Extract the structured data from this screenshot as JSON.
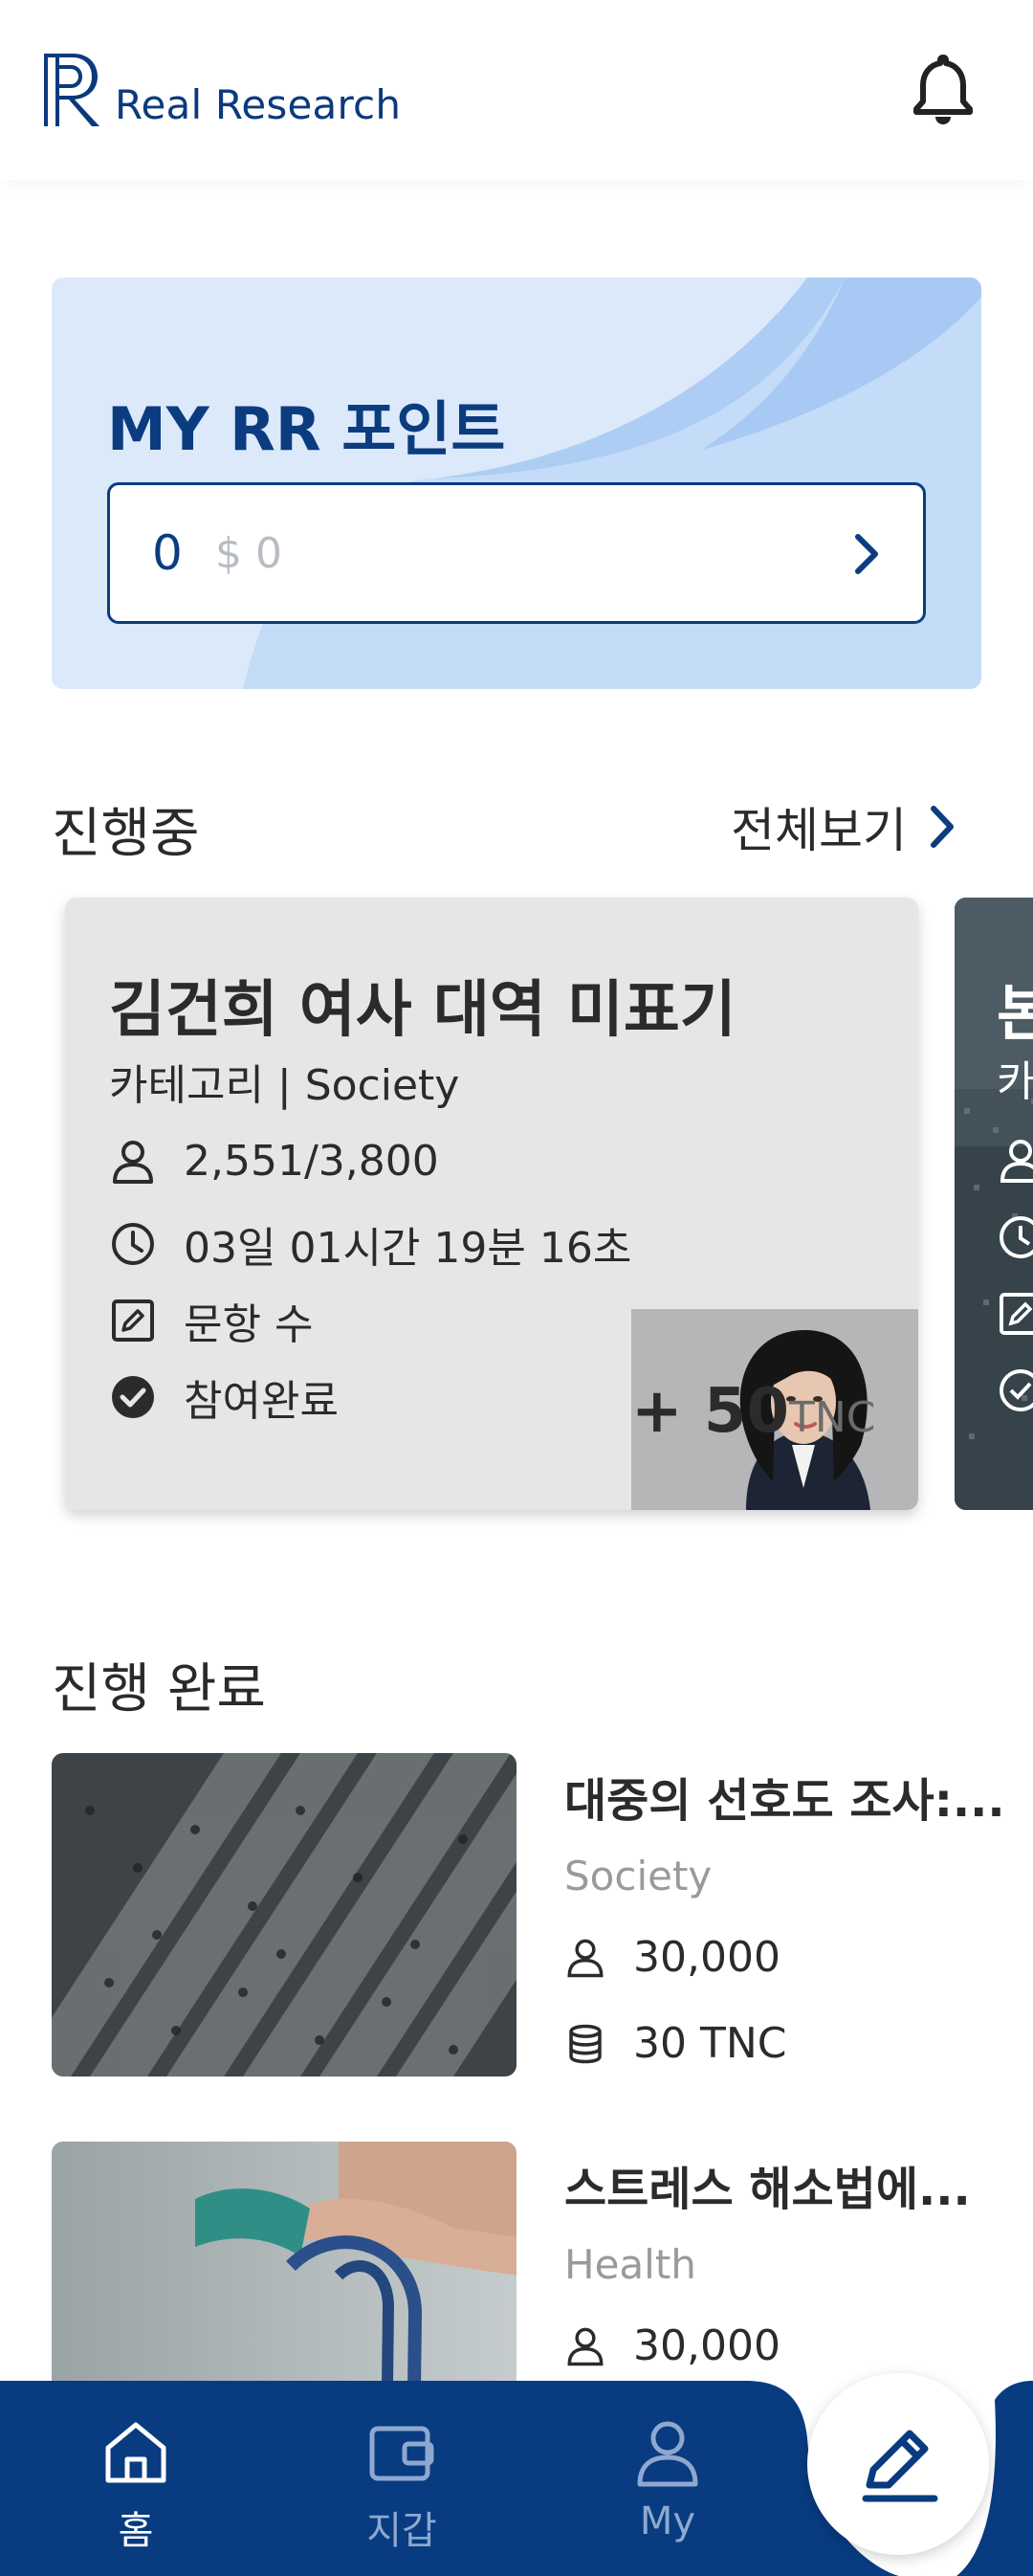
{
  "header": {
    "logo_text": "Real Research",
    "notification_icon": "bell-icon"
  },
  "points": {
    "title": "MY RR 포인트",
    "value": "0",
    "usd": "$ 0",
    "arrow_icon": "chevron-right-icon"
  },
  "ongoing": {
    "section_title": "진행중",
    "see_all_label": "전체보기",
    "cards": [
      {
        "title": "김건희 여사 대역 미표기",
        "category": "카테고리 | Society",
        "participants": "2,551/3,800",
        "time_left": "03일 01시간 19분 16초",
        "questions": "문항 수",
        "status": "참여완료",
        "reward_amount": "+ 50",
        "reward_unit": "TNC"
      },
      {
        "title": "본",
        "category": "카"
      }
    ]
  },
  "completed": {
    "section_title": "진행 완료",
    "items": [
      {
        "title": "대중의 선호도 조사:...",
        "category": "Society",
        "participants": "30,000",
        "reward": "30 TNC"
      },
      {
        "title": "스트레스 해소법에...",
        "category": "Health",
        "participants": "30,000"
      }
    ]
  },
  "bottom_nav": {
    "items": [
      {
        "label": "홈",
        "icon": "home-icon"
      },
      {
        "label": "지갑",
        "icon": "wallet-icon"
      },
      {
        "label": "My",
        "icon": "user-icon"
      }
    ],
    "fab_icon": "pencil-icon"
  },
  "colors": {
    "primary": "#0b3c7f",
    "nav_bg": "#083b80",
    "card_bg": "#e6e6e6",
    "points_bg": "#dbe9fb"
  }
}
